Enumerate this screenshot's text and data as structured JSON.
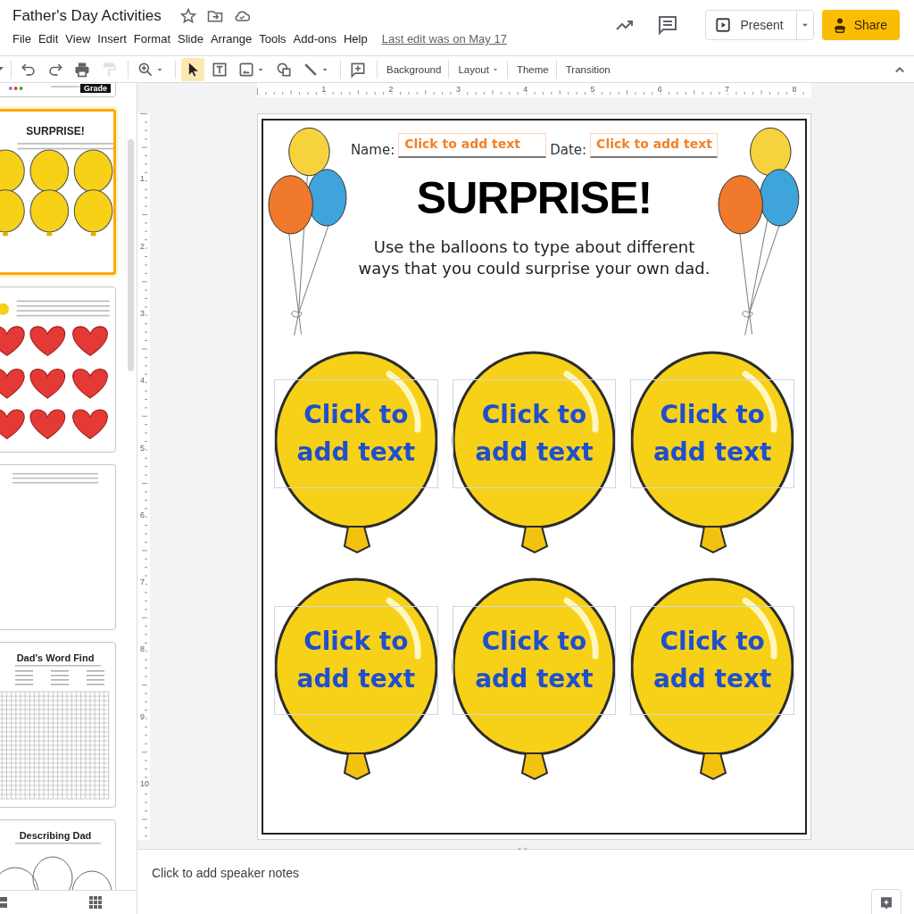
{
  "document": {
    "title": "Father's Day Activities",
    "last_edit": "Last edit was on May 17"
  },
  "menu": [
    "File",
    "Edit",
    "View",
    "Insert",
    "Format",
    "Slide",
    "Arrange",
    "Tools",
    "Add-ons",
    "Help"
  ],
  "header_buttons": {
    "present": "Present",
    "share": "Share"
  },
  "tool_groups": [
    [
      {
        "kind": "caret",
        "selected": false,
        "disabled": false
      }
    ],
    [
      {
        "kind": "undo",
        "selected": false,
        "disabled": false
      },
      {
        "kind": "redo",
        "selected": false,
        "disabled": false
      },
      {
        "kind": "print",
        "selected": false,
        "disabled": false
      },
      {
        "kind": "paint-format",
        "selected": false,
        "disabled": true
      }
    ],
    [
      {
        "kind": "zoom",
        "selected": false,
        "disabled": false,
        "dropdown": true
      }
    ],
    [
      {
        "kind": "select",
        "selected": true,
        "disabled": false
      },
      {
        "kind": "text-box",
        "selected": false,
        "disabled": false
      },
      {
        "kind": "image",
        "selected": false,
        "disabled": false,
        "dropdown": true
      },
      {
        "kind": "shape",
        "selected": false,
        "disabled": false
      },
      {
        "kind": "line",
        "selected": false,
        "disabled": false,
        "dropdown": true
      }
    ],
    [
      {
        "kind": "comment",
        "selected": false,
        "disabled": false
      }
    ]
  ],
  "actions": [
    {
      "label": "Background",
      "dropdown": false
    },
    {
      "label": "Layout",
      "dropdown": true
    },
    {
      "label": "Theme",
      "dropdown": false
    },
    {
      "label": "Transition",
      "dropdown": false
    }
  ],
  "thumbnails": [
    {
      "kind": "banner",
      "badge": "Grade",
      "selected": false
    },
    {
      "kind": "balloons",
      "title": "SURPRISE!",
      "selected": true
    },
    {
      "kind": "hearts",
      "selected": false
    },
    {
      "kind": "memory",
      "selected": false
    },
    {
      "kind": "word-find",
      "title": "Dad's Word Find",
      "selected": false
    },
    {
      "kind": "describing",
      "title": "Describing Dad",
      "selected": false
    }
  ],
  "ruler": {
    "horizontal": [
      "1",
      "2",
      "3",
      "4",
      "5",
      "6",
      "7",
      "8"
    ],
    "vertical": [
      "1",
      "2",
      "3",
      "4",
      "5",
      "6",
      "7",
      "8",
      "9",
      "10"
    ]
  },
  "slide": {
    "name_label": "Name:",
    "name_placeholder": "Click to add text",
    "date_label": "Date:",
    "date_placeholder": "Click to add text",
    "title": "SURPRISE!",
    "instructions": [
      "Use the balloons to type about different",
      "ways that you could surprise your own dad."
    ],
    "balloons": [
      {
        "placeholder": "Click to add text"
      },
      {
        "placeholder": "Click to add text"
      },
      {
        "placeholder": "Click to add text"
      },
      {
        "placeholder": "Click to add text"
      },
      {
        "placeholder": "Click to add text"
      },
      {
        "placeholder": "Click to add text"
      }
    ]
  },
  "notes": {
    "placeholder": "Click to add speaker notes"
  }
}
